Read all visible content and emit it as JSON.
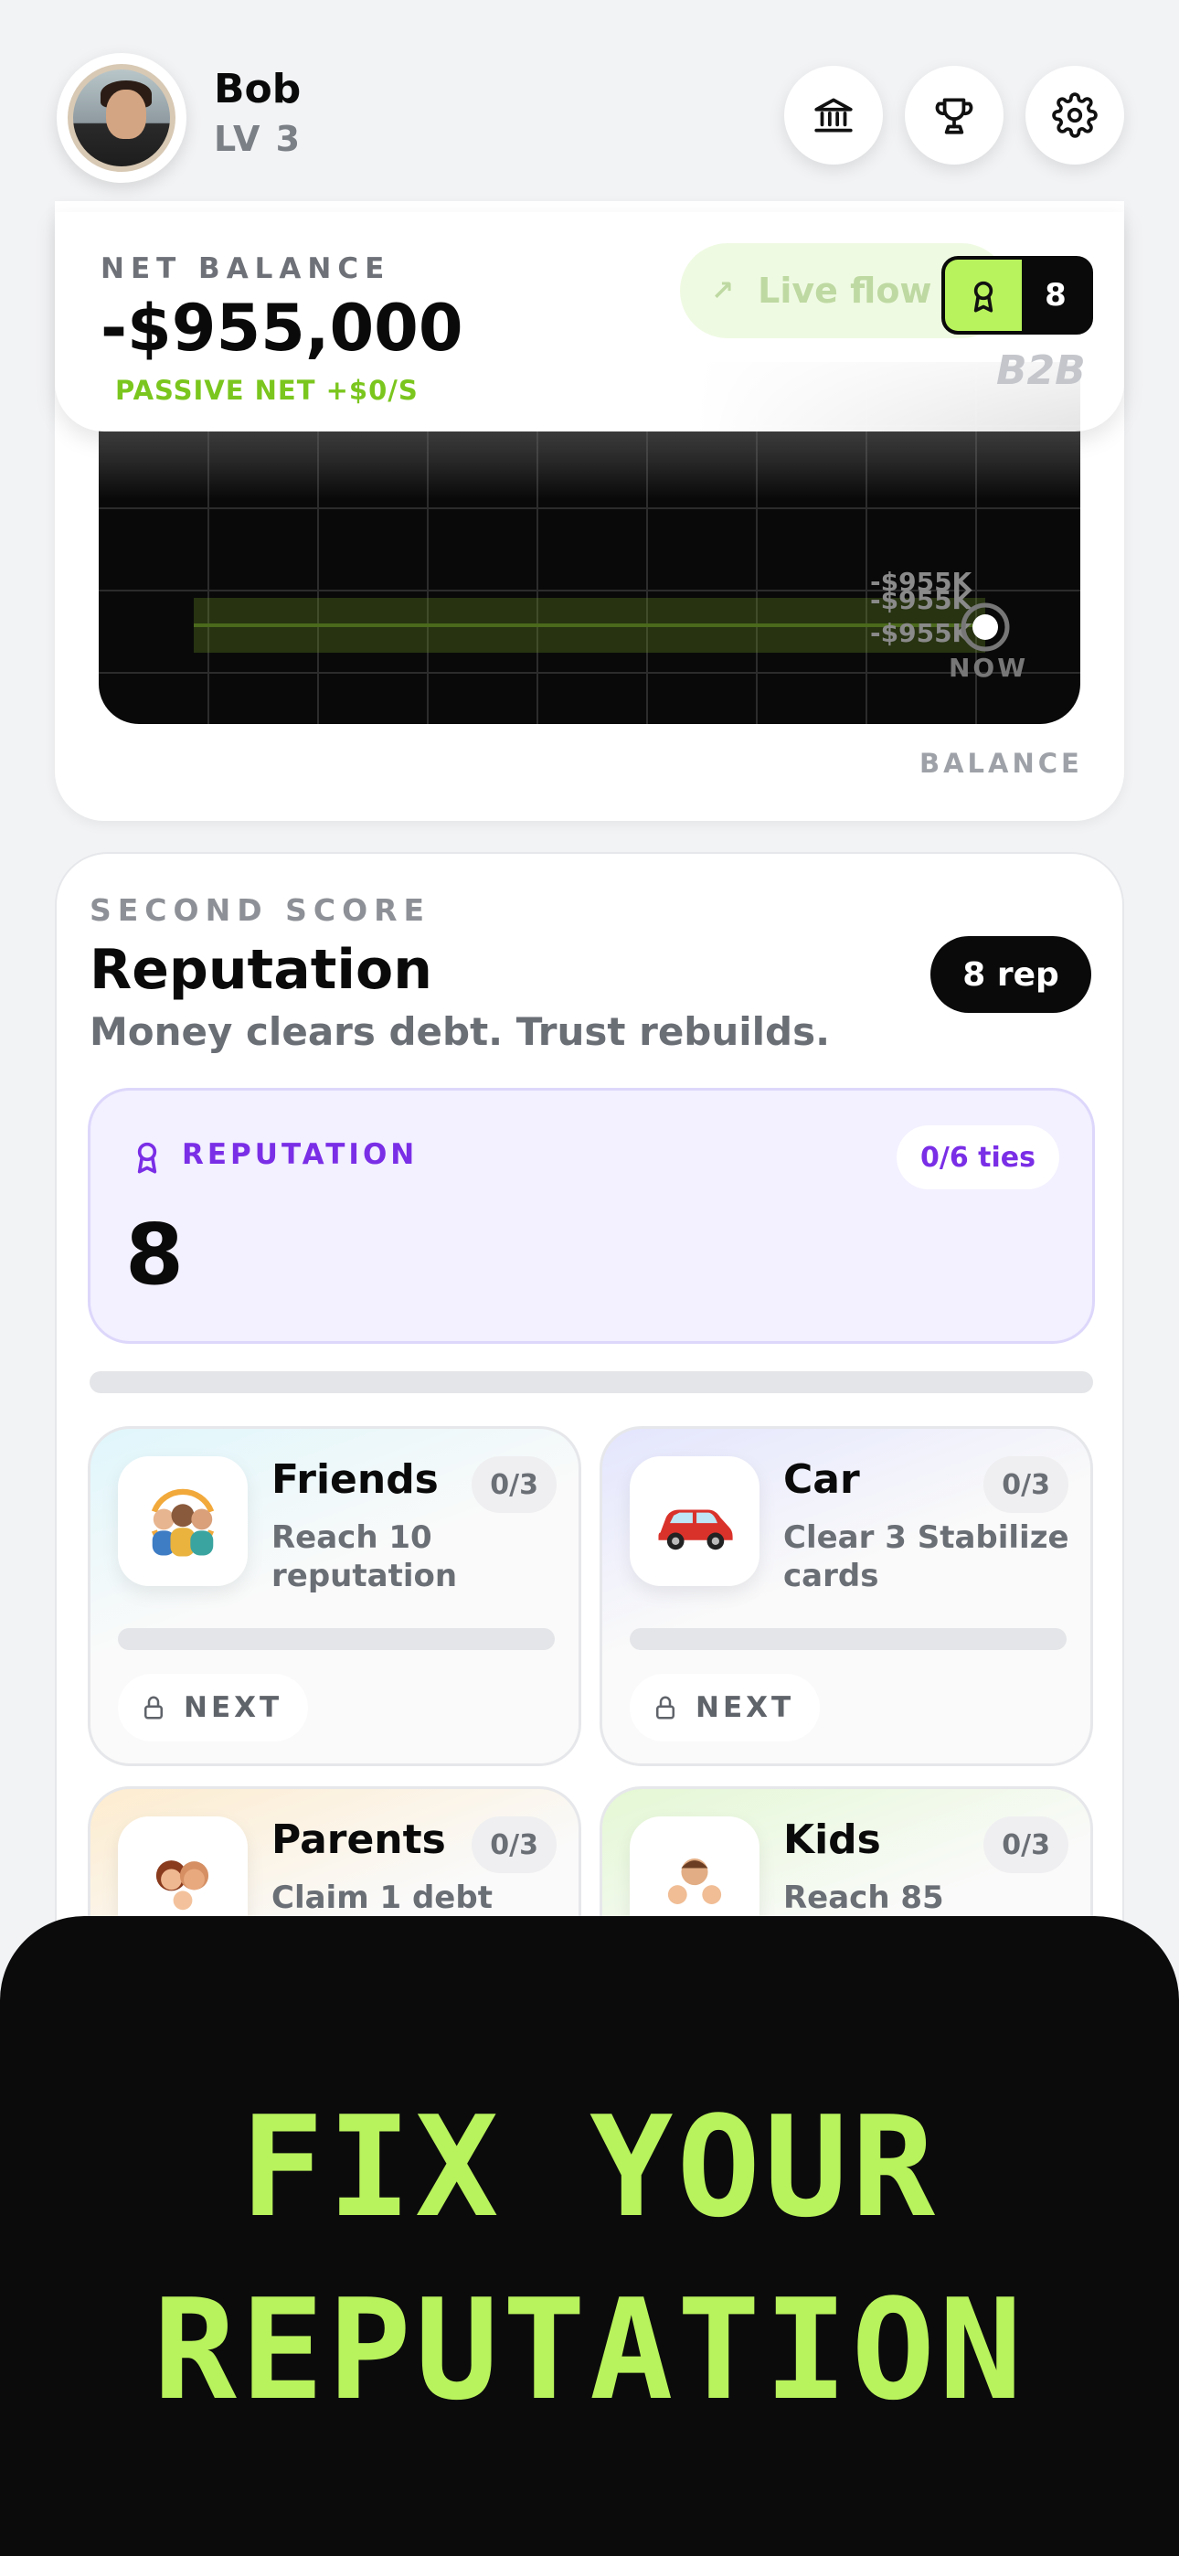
{
  "user": {
    "name": "Bob",
    "level": "LV 3"
  },
  "header_icons": [
    "bank-icon",
    "trophy-icon",
    "gear-icon"
  ],
  "balance": {
    "label": "NET BALANCE",
    "value": "-$955,000",
    "passive": "PASSIVE NET +$0/S",
    "live_flow": "Live flow",
    "rep_count": "8",
    "brand": "B2B",
    "axis_label": "BALANCE",
    "chart_labels": [
      "-$955K",
      "-$955K",
      "-$955K"
    ],
    "now_label": "NOW"
  },
  "chart_data": {
    "type": "line",
    "title": "",
    "xlabel": "",
    "ylabel": "BALANCE",
    "series": [
      {
        "values": [
          -955000,
          -955000,
          -955000
        ]
      }
    ],
    "tick_labels": [
      "-$955K",
      "-$955K",
      "-$955K"
    ],
    "annotations": [
      "NOW"
    ],
    "grid": true
  },
  "reputation": {
    "section_label": "SECOND SCORE",
    "title": "Reputation",
    "badge": "8 rep",
    "subtitle": "Money clears debt. Trust rebuilds.",
    "box_label": "REPUTATION",
    "ties_progress": "0/6 ties",
    "value": "8",
    "progress_fraction": 0.0,
    "ties": [
      {
        "name": "Friends",
        "count": "0/3",
        "desc": "Reach 10 reputation",
        "next": "NEXT",
        "icon": "friends-icon"
      },
      {
        "name": "Car",
        "count": "0/3",
        "desc": "Clear 3 Stabilize cards",
        "next": "NEXT",
        "icon": "car-icon"
      },
      {
        "name": "Parents",
        "count": "0/3",
        "desc": "Claim 1 debt",
        "icon": "parents-icon"
      },
      {
        "name": "Kids",
        "count": "0/3",
        "desc": "Reach 85",
        "icon": "kids-icon"
      }
    ]
  },
  "promo": {
    "line1": "FIX YOUR",
    "line2": "REPUTATION"
  },
  "colors": {
    "accent": "#b8f25c",
    "purple": "#7a2ee6",
    "dark": "#0b0b0c"
  }
}
